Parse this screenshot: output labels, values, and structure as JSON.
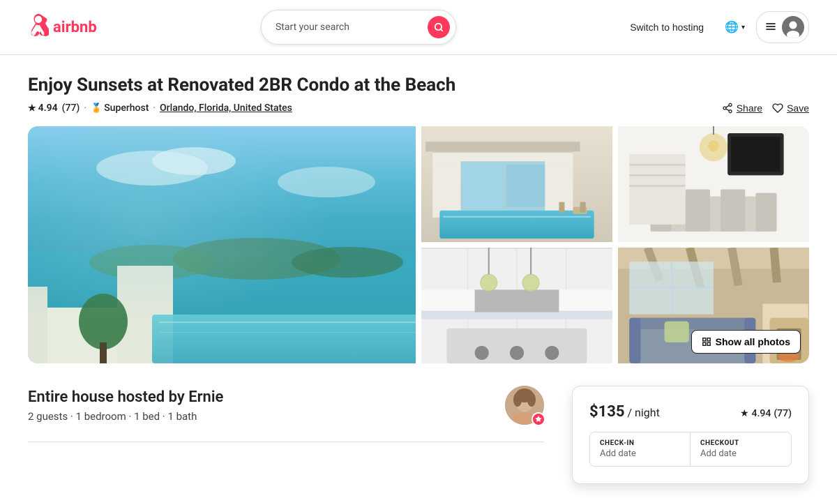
{
  "navbar": {
    "logo_text": "airbnb",
    "search_placeholder": "Start your search",
    "switch_hosting_label": "Switch to hosting",
    "menu_icon": "☰"
  },
  "listing": {
    "title": "Enjoy Sunsets at Renovated 2BR Condo at the Beach",
    "rating": "4.94",
    "review_count": "77",
    "superhost_label": "Superhost",
    "location": "Orlando, Florida, United States",
    "share_label": "Share",
    "save_label": "Save",
    "show_all_photos": "Show all photos"
  },
  "host": {
    "title": "Entire house hosted by Ernie",
    "details": "2 guests · 1 bedroom · 1 bed · 1 bath"
  },
  "booking": {
    "price": "$135",
    "per_night": "/ night",
    "rating": "4.94",
    "review_count": "77",
    "checkin_label": "CHECK-IN",
    "checkin_value": "",
    "checkout_label": "CHECKOUT",
    "checkout_value": ""
  }
}
